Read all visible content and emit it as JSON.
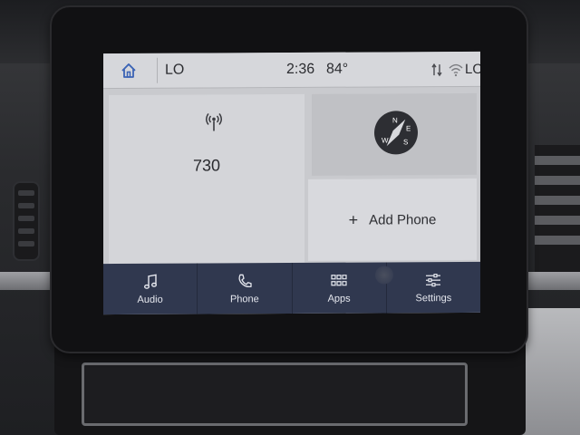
{
  "status_bar": {
    "left_label": "LO",
    "time": "2:36",
    "temperature": "84°",
    "right_label": "LO"
  },
  "radio": {
    "station": "730"
  },
  "compass": {
    "directions": [
      "N",
      "E",
      "S",
      "W"
    ]
  },
  "phone_tile": {
    "plus": "+",
    "label": "Add Phone"
  },
  "nav": {
    "items": [
      {
        "label": "Audio",
        "icon": "music-note-icon"
      },
      {
        "label": "Phone",
        "icon": "phone-icon"
      },
      {
        "label": "Apps",
        "icon": "apps-grid-icon"
      },
      {
        "label": "Settings",
        "icon": "settings-sliders-icon"
      }
    ]
  },
  "colors": {
    "nav_bg": "#30384f",
    "screen_bg": "#c9cace",
    "home_icon": "#3b63b5"
  }
}
